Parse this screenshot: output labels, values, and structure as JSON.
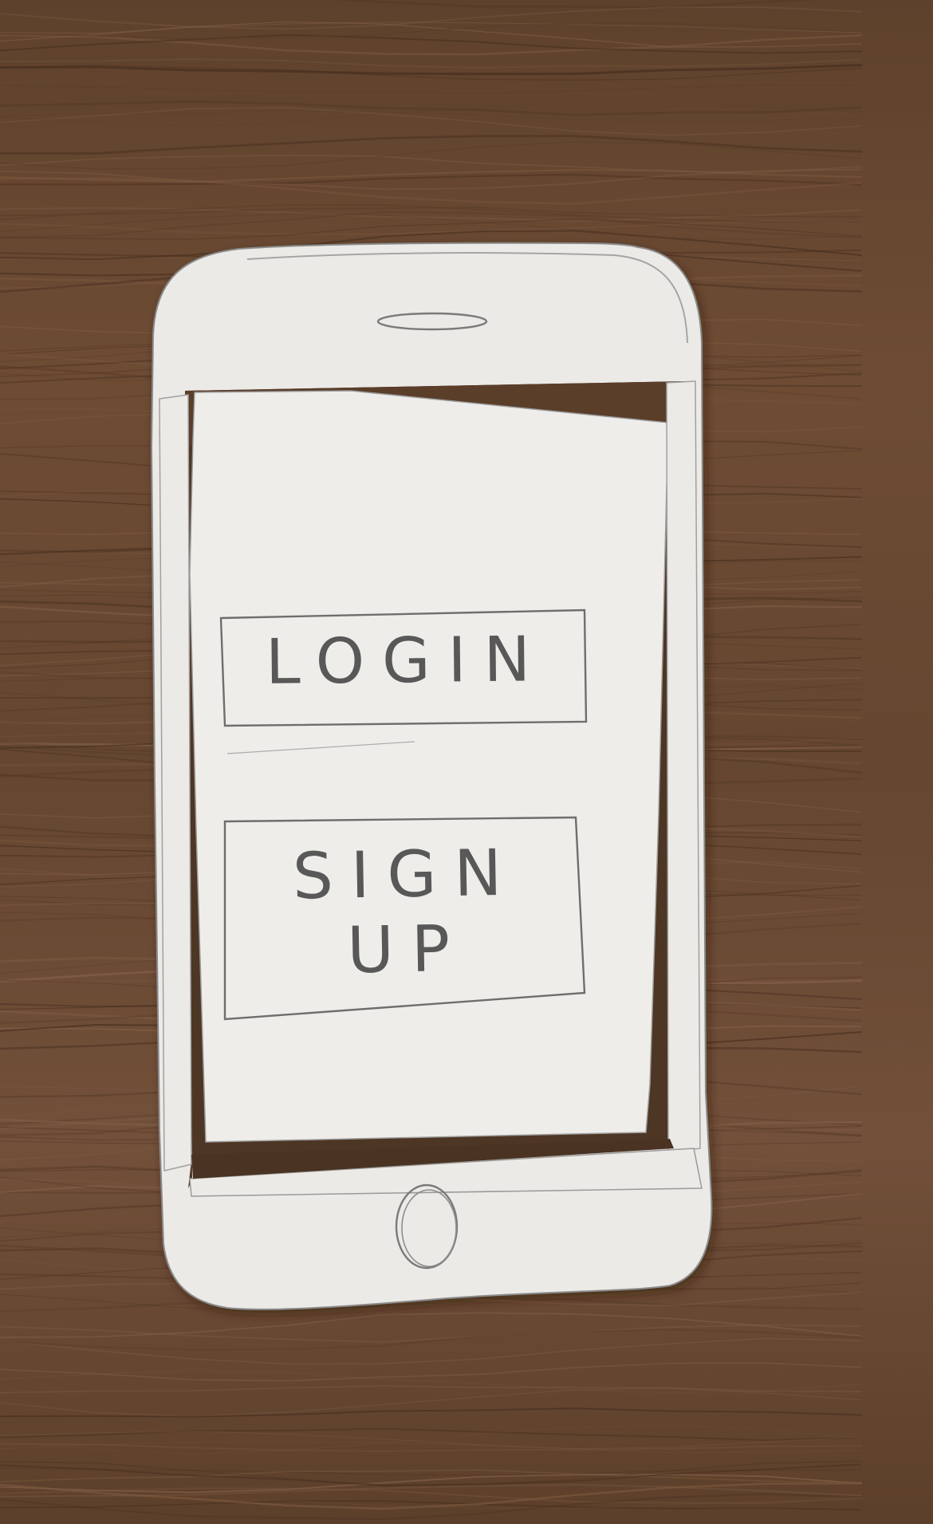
{
  "screen": {
    "buttons": {
      "login_label": "LOGIN",
      "signup_label_line1": "SIGN",
      "signup_label_line2": "UP"
    }
  },
  "phone": {
    "earpiece_icon": "speaker-slot-icon",
    "home_button_icon": "home-button-icon"
  },
  "colors": {
    "wood_base": "#6b4a33",
    "paper": "#eeecea",
    "pencil": "#6a6a6a"
  }
}
